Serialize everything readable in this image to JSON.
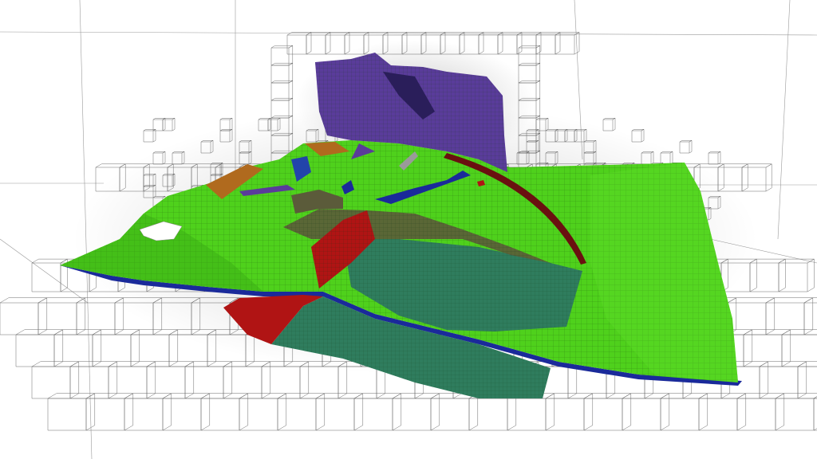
{
  "colors": {
    "background": "#ffffff",
    "octree_lines": "#6d6d6d",
    "terrain_green": "#4fd11c",
    "terrain_green_dark": "#37a814",
    "teal_body": "#2f7d5e",
    "purple_block": "#5a3c9a",
    "red_fault": "#b01414",
    "dark_red_fault": "#6a1010",
    "olive_layer": "#5b5b3a",
    "orange_patch": "#b06a1e",
    "blue_edge": "#1a2a9a",
    "white_hole": "#ffffff"
  },
  "objects": [
    {
      "id": "octree-grid",
      "icon": "wireframe-grid"
    },
    {
      "id": "terrain-surface",
      "icon": "green-mesh"
    },
    {
      "id": "geological-bodies",
      "icon": "colored-volumes"
    }
  ]
}
